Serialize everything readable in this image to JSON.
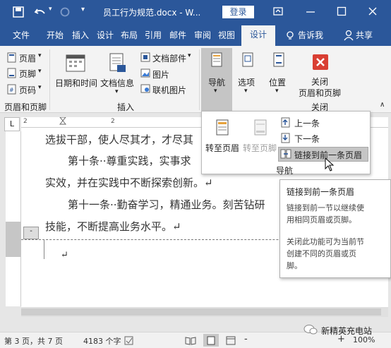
{
  "titlebar": {
    "doc_title": "员工行为规范.docx - W...",
    "login": "登录",
    "icons": [
      "save-icon",
      "undo-icon",
      "redo-icon",
      "quick-access-dropdown-icon",
      "ribbon-display-icon",
      "minimize-icon",
      "maximize-icon",
      "close-icon"
    ]
  },
  "tabs": [
    "文件",
    "开始",
    "插入",
    "设计",
    "布局",
    "引用",
    "邮件",
    "审阅",
    "视图",
    "设计"
  ],
  "tell_me": "告诉我",
  "share": "共享",
  "ribbon": {
    "header": "页眉",
    "footer": "页脚",
    "page_number": "页码",
    "group_header_footer": "页眉和页脚",
    "date_time": "日期和时间",
    "doc_info": "文档信息",
    "doc_parts": "文档部件",
    "picture": "图片",
    "online_picture": "联机图片",
    "group_insert": "插入",
    "navigation": "导航",
    "options": "选项",
    "position": "位置",
    "close_label_1": "关闭",
    "close_label_2": "页眉和页脚",
    "group_close": "关闭"
  },
  "nav_popup": {
    "goto_header": "转至页眉",
    "goto_footer": "转至页脚",
    "previous": "上一条",
    "next": "下一条",
    "link_previous": "链接到前一条页眉",
    "group_label": "导航"
  },
  "tooltip": {
    "title": "链接到前一条页眉",
    "line1": "链接到前一节以继续使",
    "line2": "用相同页眉或页脚。",
    "line3": "关闭此功能可为当前节",
    "line4": "创建不同的页眉或页",
    "line5": "脚。"
  },
  "document": {
    "line1": "选拔干部，使人尽其才，才尽其",
    "line2": "第十条··尊重实践，实事求",
    "line3": "实效，并在实践中不断探索创新。↵",
    "line4": "第十一条··勤奋学习，精通业务。刻苦钻研",
    "line5": "技能，不断提高业务水平。↵",
    "cursor_mark": "↵"
  },
  "ruler_marks": [
    "2",
    "2"
  ],
  "ruler_corner": "L",
  "status": {
    "page": "第 3 页，共 7 页",
    "words": "4183 个字",
    "zoom": "100%",
    "zoom_minus": "-",
    "zoom_plus": "+",
    "watermark": "新精英充电站"
  },
  "colors": {
    "accent": "#2b579a",
    "close_red": "#d93f33",
    "highlight": "#c5c5c5"
  }
}
